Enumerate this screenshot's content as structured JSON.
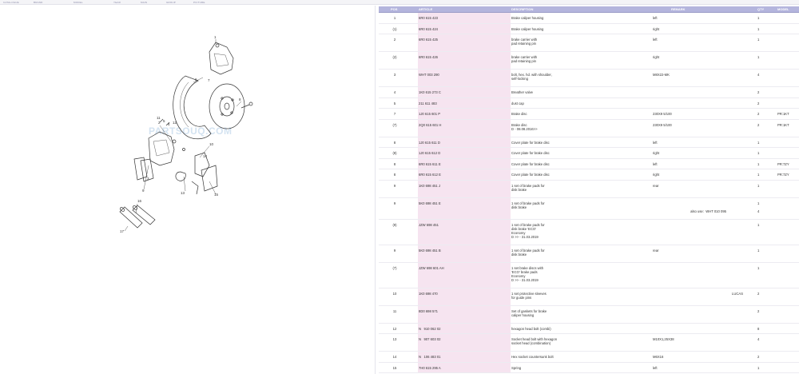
{
  "topnav": [
    "CATALOGUE",
    "BRAND",
    "MODEL",
    "YEAR",
    "MAIN",
    "GROUP",
    "PICTURE"
  ],
  "diagram": {
    "watermark": "PARTSOUQ.COM",
    "callouts": [
      "1",
      "2",
      "3",
      "4",
      "5",
      "6",
      "7",
      "8",
      "9",
      "10",
      "11",
      "12",
      "13",
      "14",
      "15",
      "16",
      "17"
    ]
  },
  "table": {
    "headers": {
      "pos": "POS",
      "article": "ARTICLE",
      "description": "DESCRIPTION",
      "remark": "REMARK",
      "qty": "QTY",
      "model": "MODEL"
    },
    "rows": [
      {
        "pos": "1",
        "article": "6R0 615 423",
        "description": "Brake caliper housing",
        "remark": "left",
        "qty": "1",
        "model": "",
        "extra_note": "",
        "extra_qty": ""
      },
      {
        "pos": "(1)",
        "article": "6R0 615 424",
        "description": "Brake caliper housing",
        "remark": "right",
        "qty": "1",
        "model": "",
        "extra_note": "",
        "extra_qty": ""
      },
      {
        "pos": "2",
        "article": "6R0 615 425",
        "description": "brake carrier with\npad retaining pin",
        "remark": "left",
        "qty": "1",
        "model": "",
        "extra_note": "",
        "extra_qty": ""
      },
      {
        "pos": "(2)",
        "article": "6R0 615 426",
        "description": "brake carrier with\npad retaining pin",
        "remark": "right",
        "qty": "1",
        "model": "",
        "extra_note": "",
        "extra_qty": ""
      },
      {
        "pos": "3",
        "article": "WHT 003 290",
        "description": "bolt, hex. hd. with shoulder,\nself-locking",
        "remark": "M8X22-MK",
        "qty": "4",
        "model": "",
        "extra_note": "",
        "extra_qty": ""
      },
      {
        "pos": "4",
        "article": "1K0 615 273 C",
        "description": "Breather valve",
        "remark": "",
        "qty": "2",
        "model": "",
        "extra_note": "",
        "extra_qty": ""
      },
      {
        "pos": "5",
        "article": "211 611 483",
        "description": "dust cap",
        "remark": "",
        "qty": "2",
        "model": "",
        "extra_note": "",
        "extra_qty": ""
      },
      {
        "pos": "7",
        "article": "1J0 615 601 P",
        "description": "Brake disc",
        "remark": "230X9   5/100",
        "qty": "2",
        "model": "PR:1KT",
        "extra_note": "",
        "extra_qty": ""
      },
      {
        "pos": "(7)",
        "article": "2Q0 615 601 H",
        "description": "Brake disc\nD  - 08.08.2016>>",
        "remark": "230X9   5/100",
        "qty": "2",
        "model": "PR:1KT",
        "extra_note": "",
        "extra_qty": ""
      },
      {
        "pos": "8",
        "article": "1J0 615 611 D",
        "description": "Cover plate for brake disc",
        "remark": "left",
        "qty": "1",
        "model": "",
        "extra_note": "",
        "extra_qty": ""
      },
      {
        "pos": "(8)",
        "article": "1J0 615 612 D",
        "description": "Cover plate for brake disc",
        "remark": "right",
        "qty": "1",
        "model": "",
        "extra_note": "",
        "extra_qty": ""
      },
      {
        "pos": "8",
        "article": "6R0 615 611 E",
        "description": "Cover plate for brake disc",
        "remark": "left",
        "qty": "1",
        "model": "PR:7ZY",
        "extra_note": "",
        "extra_qty": ""
      },
      {
        "pos": "8",
        "article": "6R0 615 612 E",
        "description": "Cover plate for brake disc",
        "remark": "right",
        "qty": "1",
        "model": "PR:7ZY",
        "extra_note": "",
        "extra_qty": ""
      },
      {
        "pos": "9",
        "article": "1K0 698 451 J",
        "description": "1 set of brake pads for\ndisk brake",
        "remark": "rear",
        "qty": "1",
        "model": "",
        "extra_note": "",
        "extra_qty": ""
      },
      {
        "pos": "9",
        "article": "5K0 698 451 E",
        "description": "1 set of brake pads for\ndisk brake",
        "remark": "",
        "qty": "1",
        "model": "",
        "extra_note": "also use:  WHT 010 095",
        "extra_qty": "4"
      },
      {
        "pos": "(9)",
        "article": "JZW 698 451",
        "description": "1 set of brake pads for\ndisk brake          'ECO'\nEconomy\nD            >> - 31.03.2019",
        "remark": "",
        "qty": "1",
        "model": "",
        "extra_note": "",
        "extra_qty": ""
      },
      {
        "pos": "9",
        "article": "5K0 698 451 B",
        "description": "1 set of brake pads for\ndisk brake",
        "remark": "rear",
        "qty": "1",
        "model": "",
        "extra_note": "",
        "extra_qty": ""
      },
      {
        "pos": "(7)",
        "article": "JZW 698 601 AH",
        "description": "1 set brake discs with\n         'ECO' brake pads\nEconomy\nD            >> - 31.03.2019",
        "remark": "",
        "qty": "1",
        "model": "",
        "extra_note": "",
        "extra_qty": ""
      },
      {
        "pos": "10",
        "article": "1K0 698 470",
        "description": "1 set protective sleeves\nfor guide pins",
        "remark": "",
        "remark2": "LUCAS",
        "qty": "2",
        "model": "",
        "extra_note": "",
        "extra_qty": ""
      },
      {
        "pos": "11",
        "article": "8D0 698 571",
        "description": "Set of gaskets for brake\ncaliper housing",
        "remark": "",
        "qty": "2",
        "model": "",
        "extra_note": "",
        "extra_qty": ""
      },
      {
        "pos": "12",
        "article": "N   910 062 02",
        "description": "hexagon head bolt (combi)",
        "remark": "",
        "qty": "8",
        "model": "",
        "extra_note": "",
        "extra_qty": ""
      },
      {
        "pos": "13",
        "article": "N   907 603 02",
        "description": "Socket head bolt with hexagon\nsocket head (combination)",
        "remark": "M10X1,25X38",
        "qty": "4",
        "model": "",
        "extra_note": "",
        "extra_qty": ""
      },
      {
        "pos": "14",
        "article": "N   106 483 01",
        "description": "Hex socket countersunk bolt",
        "remark": "M6X16",
        "qty": "2",
        "model": "",
        "extra_note": "",
        "extra_qty": ""
      },
      {
        "pos": "15",
        "article": "7H0 615 295 A",
        "description": "Spring",
        "remark": "left",
        "qty": "1",
        "model": "",
        "extra_note": "",
        "extra_qty": ""
      }
    ]
  }
}
